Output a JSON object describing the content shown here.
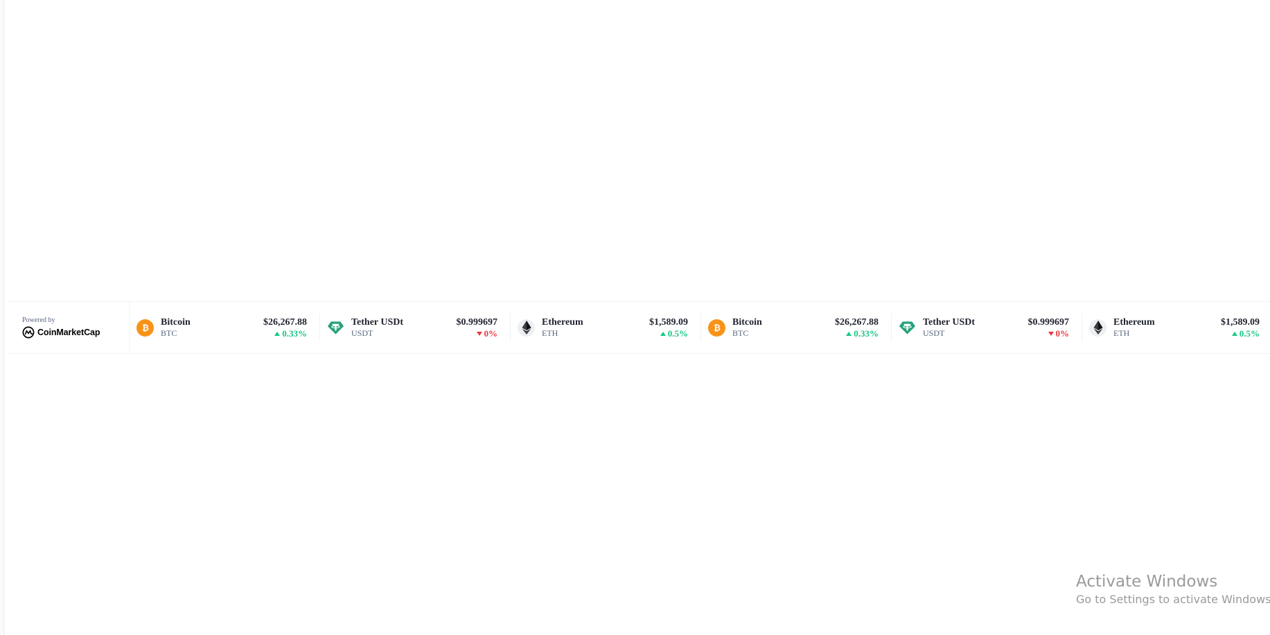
{
  "widget": {
    "powered_by": "Powered by",
    "brand_name": "CoinMarketCap"
  },
  "ticker": [
    {
      "name": "Bitcoin",
      "symbol": "BTC",
      "price": "$26,267.88",
      "change": "0.33%",
      "direction": "up",
      "icon": "bitcoin-icon",
      "color": "#f7931a"
    },
    {
      "name": "Tether USDt",
      "symbol": "USDT",
      "price": "$0.999697",
      "change": "0%",
      "direction": "down",
      "icon": "tether-icon",
      "color": "#26a17b"
    },
    {
      "name": "Ethereum",
      "symbol": "ETH",
      "price": "$1,589.09",
      "change": "0.5%",
      "direction": "up",
      "icon": "ethereum-icon",
      "color": "#3c3c3d"
    },
    {
      "name": "Bitcoin",
      "symbol": "BTC",
      "price": "$26,267.88",
      "change": "0.33%",
      "direction": "up",
      "icon": "bitcoin-icon",
      "color": "#f7931a"
    },
    {
      "name": "Tether USDt",
      "symbol": "USDT",
      "price": "$0.999697",
      "change": "0%",
      "direction": "down",
      "icon": "tether-icon",
      "color": "#26a17b"
    },
    {
      "name": "Ethereum",
      "symbol": "ETH",
      "price": "$1,589.09",
      "change": "0.5%",
      "direction": "up",
      "icon": "ethereum-icon",
      "color": "#3c3c3d"
    }
  ],
  "colors": {
    "up": "#16c784",
    "down": "#ea3943"
  },
  "watermark": {
    "title": "Activate Windows",
    "subtitle": "Go to Settings to activate Windows."
  }
}
